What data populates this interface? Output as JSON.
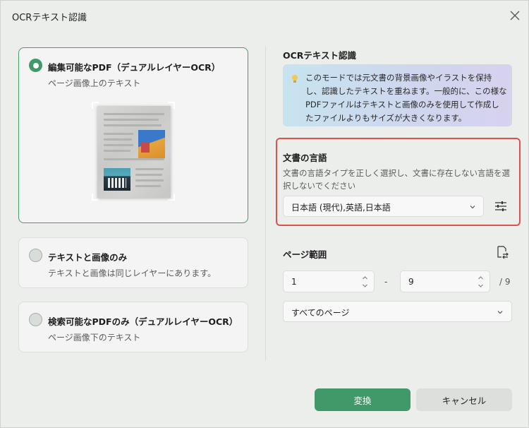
{
  "window": {
    "title": "OCRテキスト認識"
  },
  "options": [
    {
      "title": "編集可能なPDF（デュアルレイヤーOCR）",
      "desc": "ページ画像上のテキスト",
      "selected": true
    },
    {
      "title": "テキストと画像のみ",
      "desc": "テキストと画像は同じレイヤーにあります。",
      "selected": false
    },
    {
      "title": "検索可能なPDFのみ（デュアルレイヤーOCR）",
      "desc": "ページ画像下のテキスト",
      "selected": false
    }
  ],
  "ocr_section": {
    "title": "OCRテキスト認識",
    "info": "このモードでは元文書の背景画像やイラストを保持し、認識したテキストを重ねます。一般的に、この様なPDFファイルはテキストと画像のみを使用して作成したファイルよりもサイズが大きくなります。"
  },
  "language": {
    "title": "文書の言語",
    "desc": "文書の言語タイプを正しく選択し、文書に存在しない言語を選択しないでください",
    "selected": "日本語 (現代),英語,日本語"
  },
  "page_range": {
    "title": "ページ範囲",
    "from": "1",
    "to": "9",
    "dash": "-",
    "total": "/ 9",
    "scope": "すべてのページ"
  },
  "buttons": {
    "convert": "変換",
    "cancel": "キャンセル"
  },
  "colors": {
    "accent": "#3f9968",
    "highlight": "#e0504c"
  },
  "icons": {
    "close": "close-icon",
    "bulb": "lightbulb-icon",
    "settings": "sliders-icon",
    "page_swap": "page-swap-icon",
    "chevron": "chevron-down-icon",
    "stepper": "stepper-arrows-icon"
  }
}
